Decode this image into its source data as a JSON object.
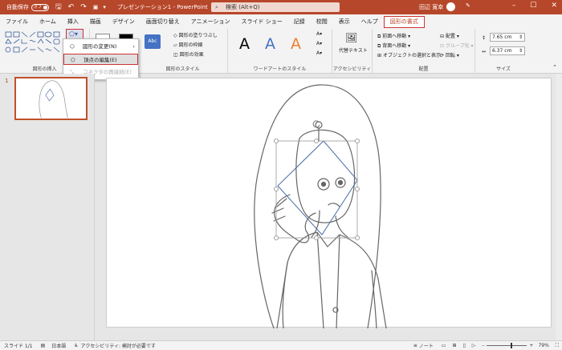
{
  "titlebar": {
    "autosave": "自動保存",
    "toggle": "オフ",
    "doc_title": "プレゼンテーション1 - PowerPoint",
    "search_placeholder": "検索 (Alt+Q)",
    "user": "田辺 寛幸"
  },
  "tabs": [
    "ファイル",
    "ホーム",
    "挿入",
    "描画",
    "デザイン",
    "画面切り替え",
    "アニメーション",
    "スライド ショー",
    "記録",
    "校閲",
    "表示",
    "ヘルプ",
    "図形の書式"
  ],
  "active_tab": "図形の書式",
  "ribbon_right": {
    "comment": "",
    "record": "記録",
    "share": "共有"
  },
  "ribbon": {
    "insert_shapes_label": "図形の挿入",
    "shape_styles_label": "図形のスタイル",
    "fill": "図形の塗りつぶし",
    "outline": "図形の枠線",
    "effects": "図形の効果",
    "wordart_label": "ワードアートのスタイル",
    "alt_text": "代替テキスト",
    "accessibility_label": "アクセシビリティ",
    "bring_forward": "前面へ移動",
    "send_backward": "背面へ移動",
    "selection_pane": "オブジェクトの選択と表示",
    "align": "配置",
    "group": "グループ化",
    "rotate": "回転",
    "arrange_label": "配置",
    "height": "7.65 cm",
    "width": "6.37 cm",
    "size_label": "サイズ",
    "abc": "Abc"
  },
  "dropdown": {
    "change_shape": "図形の変更(N)",
    "edit_points": "頂点の編集(E)",
    "reroute": "コネクタの再接続(E)"
  },
  "slide_number": "1",
  "statusbar": {
    "slide": "スライド 1/1",
    "language": "日本語",
    "accessibility": "アクセシビリティ: 検討が必要です",
    "notes": "ノート",
    "zoom": "79%"
  }
}
